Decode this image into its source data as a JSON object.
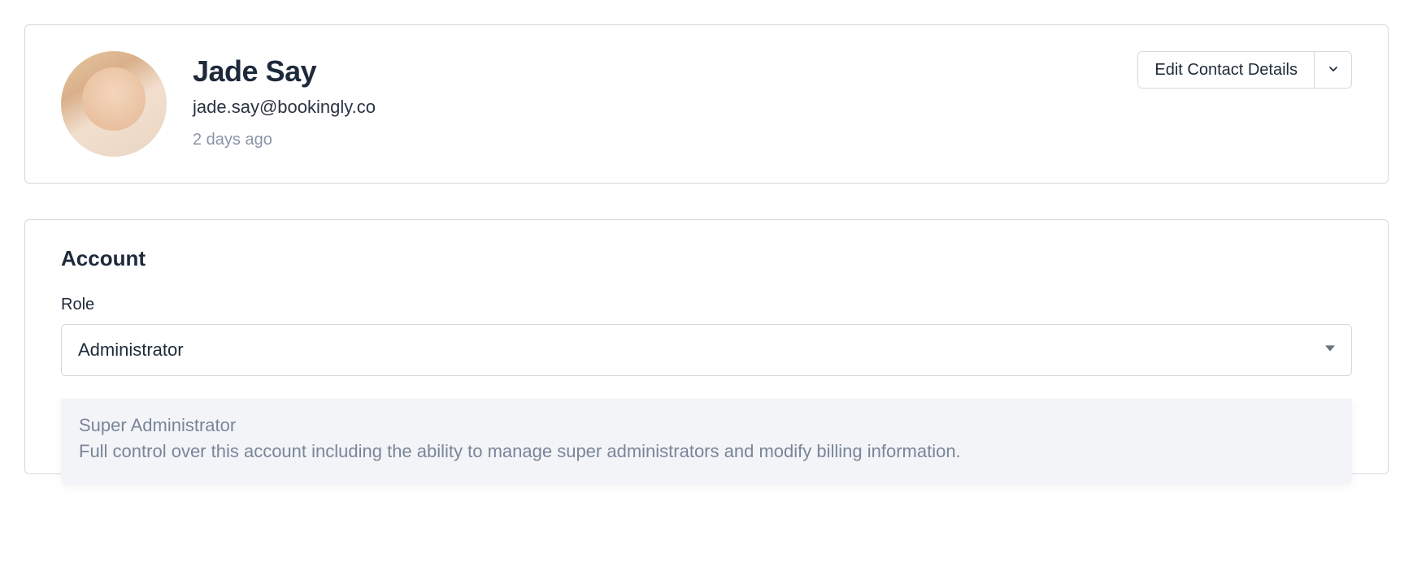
{
  "contact": {
    "name": "Jade Say",
    "email": "jade.say@bookingly.co",
    "last_seen": "2 days ago"
  },
  "actions": {
    "edit_contact_label": "Edit Contact Details"
  },
  "account": {
    "heading": "Account",
    "role_label": "Role",
    "role_selected": "Administrator",
    "dropdown_option": {
      "title": "Super Administrator",
      "description": "Full control over this account including the ability to manage super administrators and modify billing information."
    }
  }
}
